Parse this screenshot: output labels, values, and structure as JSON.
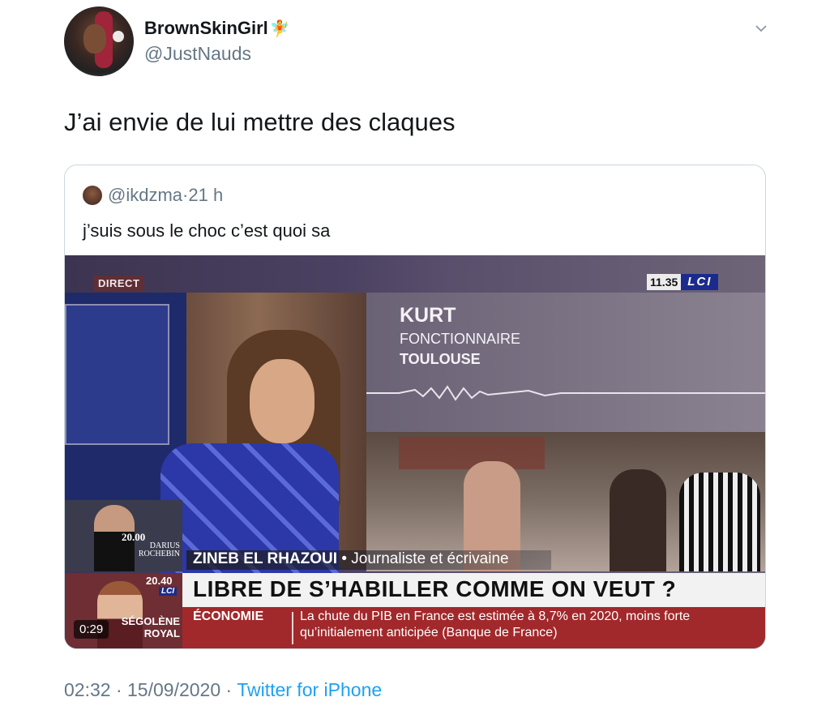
{
  "author": {
    "display_name": "BrownSkinGirl",
    "name_emoji": "🧚",
    "handle": "@JustNauds"
  },
  "tweet": {
    "text": "J’ai envie de lui mettre des claques",
    "time": "02:32",
    "date": "15/09/2020",
    "source": "Twitter for iPhone",
    "sep1": "·",
    "sep2": "·"
  },
  "quoted": {
    "handle": "@ikdzma",
    "sep": "·",
    "age": "21 h",
    "text": "j’suis sous le choc c’est quoi sa"
  },
  "video": {
    "duration": "0:29",
    "direct_label": "DIRECT",
    "clock": "11.35",
    "channel": "LCI",
    "guest_name": "KURT",
    "guest_job": "FONCTIONNAIRE",
    "guest_city": "TOULOUSE",
    "pip1_time": "20.00",
    "pip1_name_line1": "DARIUS",
    "pip1_name_line2": "ROCHEBIN",
    "caption_name": "ZINEB EL RHAZOUI",
    "caption_role": "• Journaliste et écrivaine",
    "headline": "LIBRE DE S’HABILLER COMME ON VEUT ?",
    "ticker_label": "ÉCONOMIE",
    "ticker_text": "La chute du PIB en France est estimée à 8,7% en 2020, moins forte qu’initialement anticipée (Banque de France)",
    "pip2_time": "20.40",
    "pip2_channel": "LCI",
    "pip2_name_line1": "SÉGOLÈNE",
    "pip2_name_line2": "ROYAL"
  },
  "icons": {
    "menu": "chevron-down-icon"
  },
  "colors": {
    "link": "#1da1f2",
    "secondary_text": "#657786",
    "border": "#ccd6dd",
    "ticker_red": "#a1292b",
    "lci_blue": "#1b2b8c"
  }
}
